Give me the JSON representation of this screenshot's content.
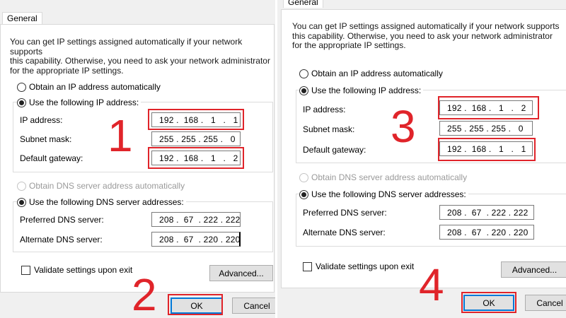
{
  "left": {
    "tab": "General",
    "description": [
      "You can get IP settings assigned automatically if your network supports",
      "this capability. Otherwise, you need to ask your network administrator",
      "for the appropriate IP settings."
    ],
    "obtain_ip_auto": "Obtain an IP address automatically",
    "use_ip": "Use the following IP address:",
    "ip_label": "IP address:",
    "ip_value": "192 .  168 .   1   .   1",
    "subnet_label": "Subnet mask:",
    "subnet_value": "255 . 255 . 255 .   0",
    "gateway_label": "Default gateway:",
    "gateway_value": "192 .  168 .   1   .   2",
    "obtain_dns_auto": "Obtain DNS server address automatically",
    "use_dns": "Use the following DNS server addresses:",
    "pref_dns_label": "Preferred DNS server:",
    "pref_dns_value": "208 .  67  . 222 . 222",
    "alt_dns_label": "Alternate DNS server:",
    "alt_dns_value": "208 .  67  . 220 . 220",
    "validate": "Validate settings upon exit",
    "advanced": "Advanced...",
    "ok": "OK",
    "cancel": "Cancel"
  },
  "right": {
    "tab": "General",
    "description": [
      "You can get IP settings assigned automatically if your network supports",
      "this capability. Otherwise, you need to ask your network administrator",
      "for the appropriate IP settings."
    ],
    "obtain_ip_auto": "Obtain an IP address automatically",
    "use_ip": "Use the following IP address:",
    "ip_label": "IP address:",
    "ip_value": "192 .  168 .   1   .   2",
    "subnet_label": "Subnet mask:",
    "subnet_value": "255 . 255 . 255 .   0",
    "gateway_label": "Default gateway:",
    "gateway_value": "192 .  168 .   1   .   1",
    "obtain_dns_auto": "Obtain DNS server address automatically",
    "use_dns": "Use the following DNS server addresses:",
    "pref_dns_label": "Preferred DNS server:",
    "pref_dns_value": "208 .  67  . 222 . 222",
    "alt_dns_label": "Alternate DNS server:",
    "alt_dns_value": "208 .  67  . 220 . 220",
    "validate": "Validate settings upon exit",
    "advanced": "Advanced...",
    "ok": "OK",
    "cancel": "Cancel"
  },
  "annotations": {
    "step1": "1",
    "step2": "2",
    "step3": "3",
    "step4": "4",
    "highlight_color": "#e0242a"
  }
}
